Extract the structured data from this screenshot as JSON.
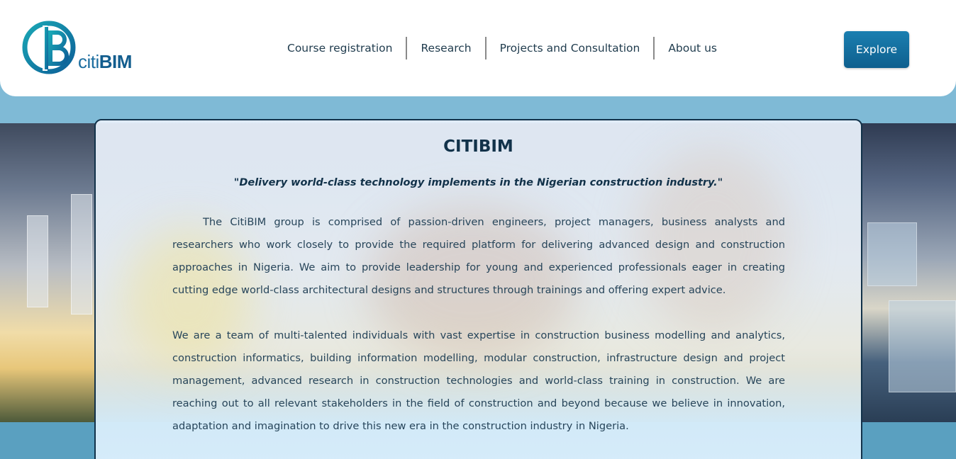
{
  "brand": {
    "logo_text_light": "citi",
    "logo_text_bold": "BIM",
    "logo_mark_letter": "B",
    "colors": {
      "primary": "#12324a",
      "accent": "#1b7fb0",
      "sky": "#7fbad6"
    }
  },
  "nav": {
    "items": [
      {
        "label": "Course registration"
      },
      {
        "label": "Research"
      },
      {
        "label": "Projects and Consultation"
      },
      {
        "label": "About us"
      }
    ]
  },
  "header": {
    "explore_label": "Explore"
  },
  "main": {
    "title": "CITIBIM",
    "tagline": "\"Delivery world-class technology implements in the Nigerian construction industry.\"",
    "paragraph_1": "The CitiBIM group is comprised of passion-driven engineers, project managers, business analysts and researchers who work closely to provide the required platform for delivering advanced design and construction approaches in Nigeria. We aim to provide leadership for young and experienced professionals eager in creating cutting edge world-class architectural designs and structures through trainings and offering expert advice.",
    "paragraph_2": "We are a team of multi-talented individuals with vast expertise in construction business modelling and analytics, construction informatics, building information modelling, modular construction, infrastructure design and project management, advanced research in construction technologies and world-class training in construction. We are reaching out to all relevant stakeholders in the field of construction and beyond because we believe in innovation, adaptation and imagination to drive this new era in the construction industry in Nigeria."
  }
}
